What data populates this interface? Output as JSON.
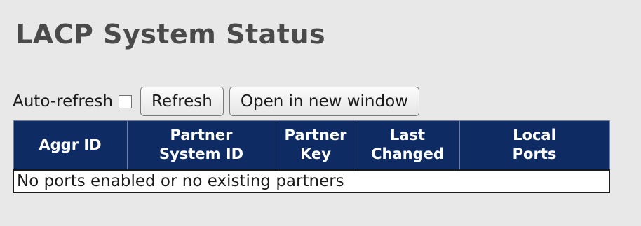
{
  "page": {
    "title": "LACP System Status"
  },
  "controls": {
    "auto_refresh_label": "Auto-refresh",
    "auto_refresh_checked": false,
    "refresh_button": "Refresh",
    "new_window_button": "Open in new window"
  },
  "table": {
    "headers": [
      [
        "Aggr ID"
      ],
      [
        "Partner",
        "System ID"
      ],
      [
        "Partner",
        "Key"
      ],
      [
        "Last",
        "Changed"
      ],
      [
        "Local",
        "Ports"
      ]
    ],
    "empty_message": "No ports enabled or no existing partners"
  },
  "colors": {
    "header_bg": "#0e2b63",
    "page_bg": "#e8e8e8",
    "title": "#4a4a4a"
  }
}
